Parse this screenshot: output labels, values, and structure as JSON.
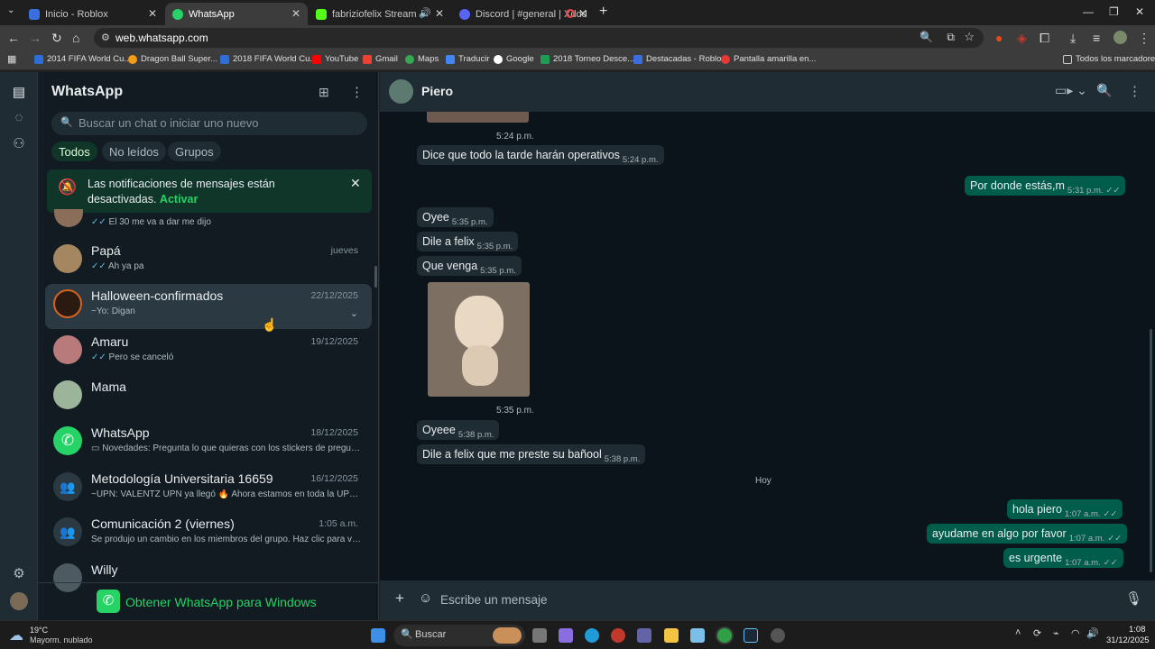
{
  "browser": {
    "tabs": [
      {
        "label": "Inicio - Roblox",
        "color": "#3b6fe0"
      },
      {
        "label": "WhatsApp",
        "color": "#25d366"
      },
      {
        "label": "fabriziofelix Stream - Watch",
        "color": "#53fc18"
      },
      {
        "label": "Discord | #general | Xddd",
        "color": "#5865f2"
      }
    ],
    "url": "web.whatsapp.com",
    "bookmarks": [
      "2014 FIFA World Cu...",
      "Dragon Ball Super...",
      "2018 FIFA World Cu...",
      "YouTube",
      "Gmail",
      "Maps",
      "Traducir",
      "Google",
      "2018 Torneo Desce...",
      "Destacadas - Roblox",
      "Pantalla amarilla en..."
    ],
    "all_bookmarks": "Todos los marcadores"
  },
  "sidebar": {
    "title": "WhatsApp",
    "search_placeholder": "Buscar un chat o iniciar uno nuevo",
    "filters": [
      "Todos",
      "No leídos",
      "Grupos"
    ],
    "notification": {
      "text": "Las notificaciones de mensajes están desactivadas.",
      "action": "Activar"
    },
    "partial_preview": "El 30 me va a dar me dijo",
    "chats": [
      {
        "name": "Papá",
        "preview": "Ah ya pa",
        "time": "jueves"
      },
      {
        "name": "Halloween-confirmados",
        "preview": "~Yo: Digan",
        "time": "22/12/2025"
      },
      {
        "name": "Amaru",
        "preview": "Pero se canceló",
        "time": "19/12/2025"
      },
      {
        "name": "Mama",
        "preview": "",
        "time": ""
      },
      {
        "name": "WhatsApp",
        "preview": "Novedades: Pregunta lo que quieras con los stickers de pregunta...",
        "time": "18/12/2025"
      },
      {
        "name": "Metodología Universitaria 16659",
        "preview": "~UPN: VALENTZ UPN ya llegó 🔥 Ahora estamos en toda la UPN. Ú...",
        "time": "16/12/2025"
      },
      {
        "name": "Comunicación 2 (viernes)",
        "preview": "Se produjo un cambio en los miembros del grupo. Haz clic para verlo.",
        "time": "1:05 a.m."
      },
      {
        "name": "Willy",
        "preview": "",
        "time": ""
      }
    ],
    "get_app": "Obtener WhatsApp para Windows"
  },
  "conversation": {
    "contact": "Piero",
    "messages": [
      {
        "text": "",
        "time": "5:24 p.m.",
        "dir": "in"
      },
      {
        "text": "Dice que todo la tarde harán operativos",
        "time": "5:24 p.m.",
        "dir": "in"
      },
      {
        "text": "Por donde estás,m",
        "time": "5:31 p.m.",
        "dir": "out"
      },
      {
        "text": "Oyee",
        "time": "5:35 p.m.",
        "dir": "in"
      },
      {
        "text": "Dile a felix",
        "time": "5:35 p.m.",
        "dir": "in"
      },
      {
        "text": "Que venga",
        "time": "5:35 p.m.",
        "dir": "in"
      },
      {
        "text": "",
        "time": "5:35 p.m.",
        "dir": "in"
      },
      {
        "text": "Oyeee",
        "time": "5:38 p.m.",
        "dir": "in"
      },
      {
        "text": "Dile a felix que me preste su bañool",
        "time": "5:38 p.m.",
        "dir": "in"
      },
      {
        "text": "hola piero",
        "time": "1:07 a.m.",
        "dir": "out"
      },
      {
        "text": "ayudame en algo por favor",
        "time": "1:07 a.m.",
        "dir": "out"
      },
      {
        "text": "es urgente",
        "time": "1:07 a.m.",
        "dir": "out"
      }
    ],
    "day_separator": "Hoy",
    "composer_placeholder": "Escribe un mensaje"
  },
  "taskbar": {
    "weather_temp": "19°C",
    "weather_desc": "Mayorm. nublado",
    "search": "Buscar",
    "time": "1:08",
    "date": "31/12/2025"
  },
  "colors": {
    "accent": "#00a884",
    "bubble_out": "#005c4b",
    "bubble_in": "#202c33",
    "panel": "#111b21"
  }
}
